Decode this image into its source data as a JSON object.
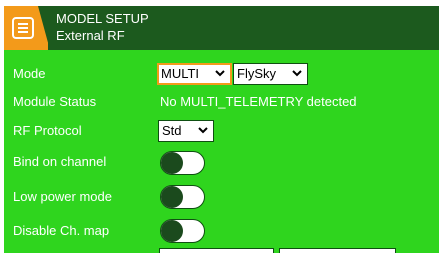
{
  "header": {
    "title": "MODEL SETUP",
    "subtitle": "External RF",
    "menu_icon": "menu-list-icon",
    "accent_color": "#f39a1a",
    "bar_color": "#1c5a1e"
  },
  "screen_bg_color": "#2fd51e",
  "rows": {
    "mode": {
      "label": "Mode",
      "dropdowns": [
        "MULTI",
        "FlySky"
      ]
    },
    "module_status": {
      "label": "Module Status",
      "value": "No MULTI_TELEMETRY detected"
    },
    "rf_protocol": {
      "label": "RF Protocol",
      "value": "Std"
    },
    "bind_on_channel": {
      "label": "Bind on channel",
      "state": "off"
    },
    "low_power_mode": {
      "label": "Low power mode",
      "state": "off"
    },
    "disable_ch_map": {
      "label": "Disable Ch. map",
      "state": "off"
    }
  }
}
